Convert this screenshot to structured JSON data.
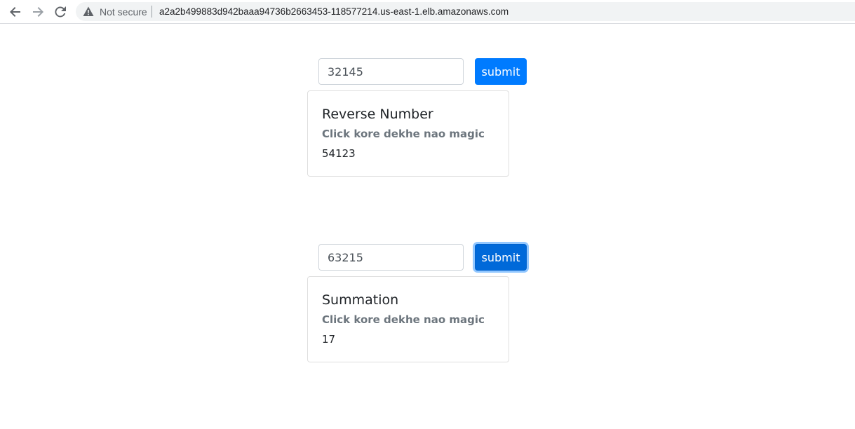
{
  "browser": {
    "back_icon": "back-arrow-icon",
    "forward_icon": "forward-arrow-icon",
    "reload_icon": "reload-icon",
    "security_icon": "warning-icon",
    "security_label": "Not secure",
    "url": "a2a2b499883d942baaa94736b2663453-118577214.us-east-1.elb.amazonaws.com"
  },
  "sections": [
    {
      "input_value": "32145",
      "button_label": "submit",
      "card": {
        "title": "Reverse Number",
        "subtitle": "Click kore dekhe nao magic",
        "result": "54123"
      }
    },
    {
      "input_value": "63215",
      "button_label": "submit",
      "card": {
        "title": "Summation",
        "subtitle": "Click kore dekhe nao magic",
        "result": "17"
      }
    }
  ],
  "colors": {
    "primary": "#007bff",
    "primary_focused": "#0069d9",
    "muted_text": "#6c757d"
  }
}
